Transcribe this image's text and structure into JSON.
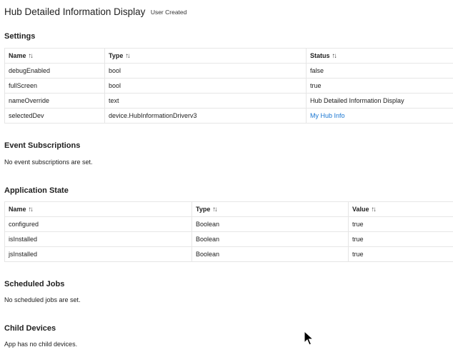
{
  "header": {
    "title": "Hub Detailed Information Display",
    "badge": "User Created"
  },
  "settings": {
    "title": "Settings",
    "columns": [
      "Name",
      "Type",
      "Status"
    ],
    "rows": [
      [
        "debugEnabled",
        "bool",
        "false"
      ],
      [
        "fullScreen",
        "bool",
        "true"
      ],
      [
        "nameOverride",
        "text",
        "Hub Detailed Information Display"
      ],
      [
        "selectedDev",
        "device.HubInformationDriverv3",
        "My Hub Info"
      ]
    ]
  },
  "event_subscriptions": {
    "title": "Event Subscriptions",
    "message": "No event subscriptions are set."
  },
  "application_state": {
    "title": "Application State",
    "columns": [
      "Name",
      "Type",
      "Value"
    ],
    "rows": [
      [
        "configured",
        "Boolean",
        "true"
      ],
      [
        "isInstalled",
        "Boolean",
        "true"
      ],
      [
        "jsInstalled",
        "Boolean",
        "true"
      ]
    ]
  },
  "scheduled_jobs": {
    "title": "Scheduled Jobs",
    "message": "No scheduled jobs are set."
  },
  "child_devices": {
    "title": "Child Devices",
    "message": "App has no child devices."
  },
  "icons": {
    "sort": "sort-icon",
    "cursor": "mouse-pointer-icon"
  },
  "colors": {
    "link": "#1976d2",
    "border": "#e6e6e6",
    "text": "#212121"
  }
}
